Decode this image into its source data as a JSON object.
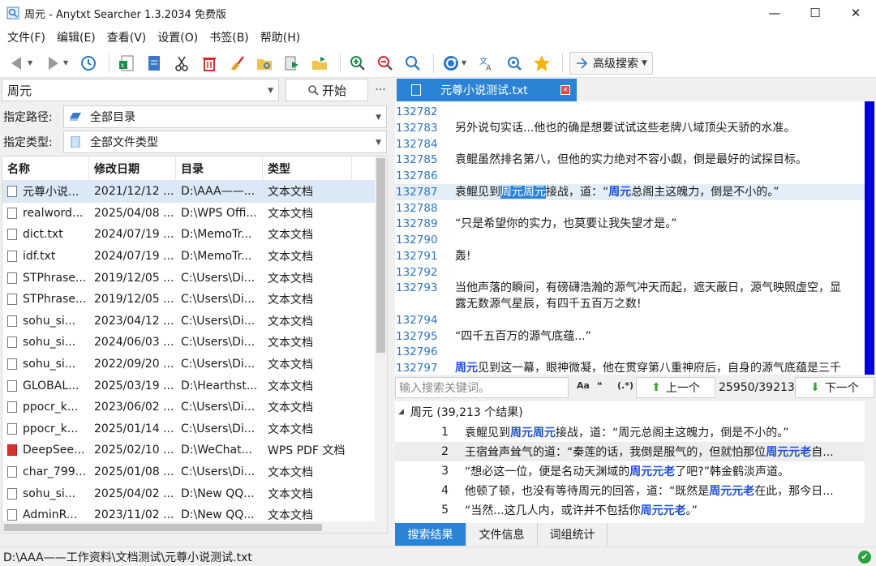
{
  "window": {
    "title": "周元 - Anytxt Searcher 1.3.2034 免费版",
    "minimize": "—",
    "maximize": "☐",
    "close": "✕"
  },
  "menu": [
    "文件(F)",
    "编辑(E)",
    "查看(V)",
    "设置(O)",
    "书签(B)",
    "帮助(H)"
  ],
  "toolbar": {
    "advanced_search": "高级搜索"
  },
  "search": {
    "query": "周元",
    "start_label": "开始",
    "more_label": "···"
  },
  "filters": {
    "path_label": "指定路径:",
    "path_value": "全部目录",
    "type_label": "指定类型:",
    "type_value": "全部文件类型"
  },
  "file_list": {
    "columns": [
      "名称",
      "修改日期",
      "目录",
      "类型"
    ],
    "rows": [
      {
        "name": "元尊小说...",
        "date": "2021/12/12 ...",
        "dir": "D:\\AAA——...",
        "type": "文本文档",
        "icon": "text-file-icon"
      },
      {
        "name": "realword...",
        "date": "2025/04/08 ...",
        "dir": "D:\\WPS Offi...",
        "type": "文本文档",
        "icon": "text-file-icon"
      },
      {
        "name": "dict.txt",
        "date": "2024/07/19 ...",
        "dir": "D:\\MemoTr...",
        "type": "文本文档",
        "icon": "text-file-icon"
      },
      {
        "name": "idf.txt",
        "date": "2024/07/19 ...",
        "dir": "D:\\MemoTr...",
        "type": "文本文档",
        "icon": "text-file-icon"
      },
      {
        "name": "STPhrase...",
        "date": "2019/12/05 ...",
        "dir": "C:\\Users\\Di...",
        "type": "文本文档",
        "icon": "text-file-icon"
      },
      {
        "name": "STPhrase...",
        "date": "2019/12/05 ...",
        "dir": "C:\\Users\\Di...",
        "type": "文本文档",
        "icon": "text-file-icon"
      },
      {
        "name": "sohu_si...",
        "date": "2023/04/12 ...",
        "dir": "C:\\Users\\Di...",
        "type": "文本文档",
        "icon": "text-file-icon"
      },
      {
        "name": "sohu_si...",
        "date": "2024/06/03 ...",
        "dir": "C:\\Users\\Di...",
        "type": "文本文档",
        "icon": "text-file-icon"
      },
      {
        "name": "sohu_si...",
        "date": "2022/09/20 ...",
        "dir": "C:\\Users\\Di...",
        "type": "文本文档",
        "icon": "text-file-icon"
      },
      {
        "name": "GLOBAL...",
        "date": "2025/03/19 ...",
        "dir": "D:\\Hearthst...",
        "type": "文本文档",
        "icon": "text-file-icon"
      },
      {
        "name": "ppocr_k...",
        "date": "2023/06/02 ...",
        "dir": "C:\\Users\\Di...",
        "type": "文本文档",
        "icon": "text-file-icon"
      },
      {
        "name": "ppocr_k...",
        "date": "2025/01/14 ...",
        "dir": "C:\\Users\\Di...",
        "type": "文本文档",
        "icon": "text-file-icon"
      },
      {
        "name": "DeepSee...",
        "date": "2025/02/10 ...",
        "dir": "D:\\WeChat...",
        "type": "WPS PDF 文档",
        "icon": "pdf-file-icon"
      },
      {
        "name": "char_799...",
        "date": "2025/01/08 ...",
        "dir": "C:\\Users\\Di...",
        "type": "文本文档",
        "icon": "text-file-icon"
      },
      {
        "name": "sohu_si...",
        "date": "2025/04/02 ...",
        "dir": "D:\\New QQ...",
        "type": "文本文档",
        "icon": "text-file-icon"
      },
      {
        "name": "AdminR...",
        "date": "2023/11/02 ...",
        "dir": "D:\\New QQ...",
        "type": "文本文档",
        "icon": "text-file-icon"
      }
    ]
  },
  "viewer": {
    "tab_title": "元尊小说测试.txt",
    "tab_close": "×",
    "lines": [
      {
        "n": "132782",
        "t": ""
      },
      {
        "n": "132783",
        "t": "另外说句实话...他也的确是想要试试这些老牌八域顶尖天骄的水准。"
      },
      {
        "n": "132784",
        "t": ""
      },
      {
        "n": "132785",
        "t": "袁鲲虽然排名第八，但他的实力绝对不容小觑，倒是最好的试探目标。"
      },
      {
        "n": "132786",
        "t": ""
      },
      {
        "n": "132787",
        "t": "",
        "parts": [
          "袁鲲见到",
          "周元周元",
          "接战，道：“",
          "周元",
          "总阁主这魄力，倒是不小的。”"
        ]
      },
      {
        "n": "132788",
        "t": ""
      },
      {
        "n": "132789",
        "t": "“只是希望你的实力，也莫要让我失望才是。”"
      },
      {
        "n": "132790",
        "t": ""
      },
      {
        "n": "132791",
        "t": "轰!"
      },
      {
        "n": "132792",
        "t": ""
      },
      {
        "n": "132793",
        "t": "当他声落的瞬间，有磅礴浩瀚的源气冲天而起，遮天蔽日，源气映照虚空，显"
      },
      {
        "n": "",
        "t": "露无数源气星辰，有四千五百万之数!"
      },
      {
        "n": "132794",
        "t": ""
      },
      {
        "n": "132795",
        "t": "“四千五百万的源气底蕴...”"
      },
      {
        "n": "132796",
        "t": ""
      },
      {
        "n": "132797",
        "t": "",
        "parts": [
          "",
          "周元",
          "见到这一幕，眼神微凝，他在贯穿第八重神府后，自身的源气底蕴是三千"
        ]
      }
    ]
  },
  "find": {
    "placeholder": "输入搜索关键词。",
    "opt_case": "Aa",
    "opt_word": "❝",
    "opt_regex": "(.*)",
    "prev_label": "上一个",
    "counter": "25950/39213",
    "next_label": "下一个"
  },
  "results": {
    "header": "周元 (39,213 个结果)",
    "rows": [
      {
        "n": "1",
        "parts": [
          "袁鲲见到",
          "周元周元",
          "接战，道：“周元总阁主这魄力，倒是不小的。”"
        ]
      },
      {
        "n": "2",
        "parts": [
          "王宿耸声耸气的道：“秦莲的话，我倒是服气的，但就怕那位",
          "周元元老",
          "自..."
        ]
      },
      {
        "n": "3",
        "parts": [
          "“想必这一位，便是名动天渊域的",
          "周元元老",
          "了吧?”韩金鹤淡声道。"
        ]
      },
      {
        "n": "4",
        "parts": [
          "他顿了顿，也没有等待周元的回答，道：“既然是",
          "周元元老",
          "在此，那今日..."
        ]
      },
      {
        "n": "5",
        "parts": [
          "“当然...这几人内，或许并不包括你",
          "周元元老",
          "。”"
        ]
      }
    ]
  },
  "bottom_tabs": [
    "搜索结果",
    "文件信息",
    "词组统计"
  ],
  "status": {
    "path": "D:\\AAA——工作资料\\文档测试\\元尊小说测试.txt"
  },
  "colors": {
    "accent": "#2b83d6",
    "keyword": "#1f4fd8",
    "line_number": "#2b76c6"
  }
}
